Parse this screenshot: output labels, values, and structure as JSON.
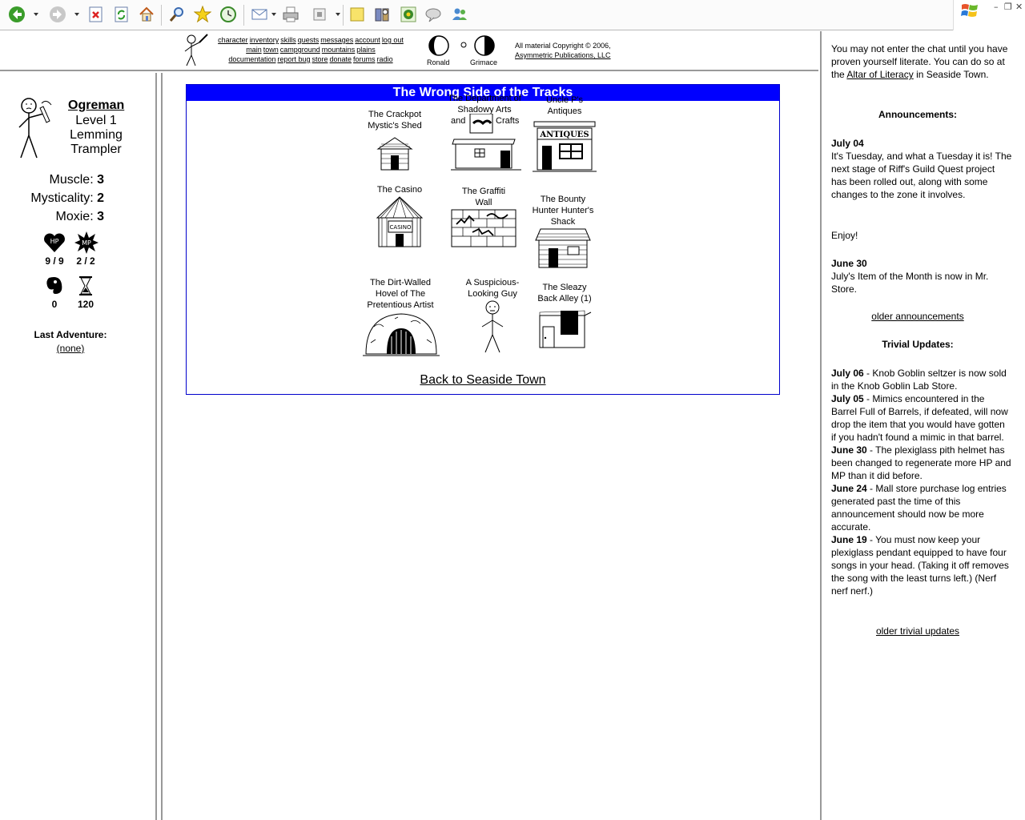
{
  "toolbar": {
    "icons": [
      "back-arrow-icon",
      "forward-arrow-icon",
      "stop-icon",
      "refresh-icon",
      "home-icon",
      "search-icon",
      "favorites-star-icon",
      "history-icon",
      "mail-icon",
      "print-icon",
      "edit-icon",
      "notes-icon",
      "research-icon",
      "messenger-icon",
      "discuss-icon",
      "contacts-icon"
    ]
  },
  "topmenu": {
    "links_row1": [
      "character",
      "inventory",
      "skills",
      "quests",
      "messages",
      "account",
      "log out"
    ],
    "links_row2": [
      "main",
      "town",
      "campground",
      "mountains",
      "plains"
    ],
    "links_row3": [
      "documentation",
      "report bug",
      "store",
      "donate",
      "forums",
      "radio"
    ],
    "moon1": "Ronald",
    "moon2": "Grimace",
    "copyright_line": "All material Copyright © 2006,",
    "copyright_link": "Asymmetric Publications, LLC"
  },
  "charpane": {
    "name": "Ogreman",
    "level": "Level 1",
    "class_line1": "Lemming",
    "class_line2": "Trampler",
    "muscle_label": "Muscle:",
    "muscle": "3",
    "mysticality_label": "Mysticality:",
    "mysticality": "2",
    "moxie_label": "Moxie:",
    "moxie": "3",
    "hp": "9 / 9",
    "mp": "2 / 2",
    "meat": "0",
    "adventures": "120",
    "hp_icon_text": "HP",
    "mp_icon_text": "MP",
    "last_adventure_label": "Last Adventure:",
    "last_adventure": "(none)"
  },
  "main": {
    "title": "The Wrong Side of the Tracks",
    "locations": [
      {
        "lines": [
          "The Crackpot",
          "Mystic's Shed"
        ]
      },
      {
        "lines": [
          "The Department of",
          "Shadowy Arts",
          "and",
          "Crafts"
        ]
      },
      {
        "lines": [
          "Uncle P's",
          "Antiques"
        ]
      },
      {
        "lines": [
          "The Casino"
        ]
      },
      {
        "lines": [
          "The Graffiti",
          "Wall"
        ]
      },
      {
        "lines": [
          "The Bounty",
          "Hunter Hunter's",
          "Shack"
        ]
      },
      {
        "lines": [
          "The Dirt-Walled",
          "Hovel of The",
          "Pretentious Artist"
        ]
      },
      {
        "lines": [
          "A Suspicious-",
          "Looking Guy"
        ]
      },
      {
        "lines": [
          "The Sleazy",
          "Back Alley (1)"
        ]
      }
    ],
    "antiques_sign": "ANTIQUES",
    "casino_sign": "CASINO",
    "back_link": "Back to Seaside Town"
  },
  "chat": {
    "intro_pre": "You may not enter the chat until you have proven yourself literate. You can do so at the",
    "intro_link": "Altar of Literacy",
    "intro_post": "in Seaside Town.",
    "announcements_title": "Announcements:",
    "ann1_date": "July 04",
    "ann1_text": "It's Tuesday, and what a Tuesday it is! The next stage of Riff's Guild Quest project has been rolled out, along with some changes to the zone it involves.",
    "ann1_extra": "Enjoy!",
    "ann2_date": "June 30",
    "ann2_text": "July's Item of the Month is now in Mr. Store.",
    "older_announcements": "older announcements",
    "trivial_title": "Trivial Updates:",
    "updates": [
      {
        "date": "July 06",
        "text": " - Knob Goblin seltzer is now sold in the Knob Goblin Lab Store."
      },
      {
        "date": "July 05",
        "text": " - Mimics encountered in the Barrel Full of Barrels, if defeated, will now drop the item that you would have gotten if you hadn't found a mimic in that barrel."
      },
      {
        "date": "June 30",
        "text": " - The plexiglass pith helmet has been changed to regenerate more HP and MP than it did before."
      },
      {
        "date": "June 24",
        "text": " - Mall store purchase log entries generated past the time of this announcement should now be more accurate."
      },
      {
        "date": "June 19",
        "text": " - You must now keep your plexiglass pendant equipped to have four songs in your head. (Taking it off removes the song with the least turns left.) (Nerf nerf nerf.)"
      }
    ],
    "older_trivial": "older trivial updates"
  }
}
